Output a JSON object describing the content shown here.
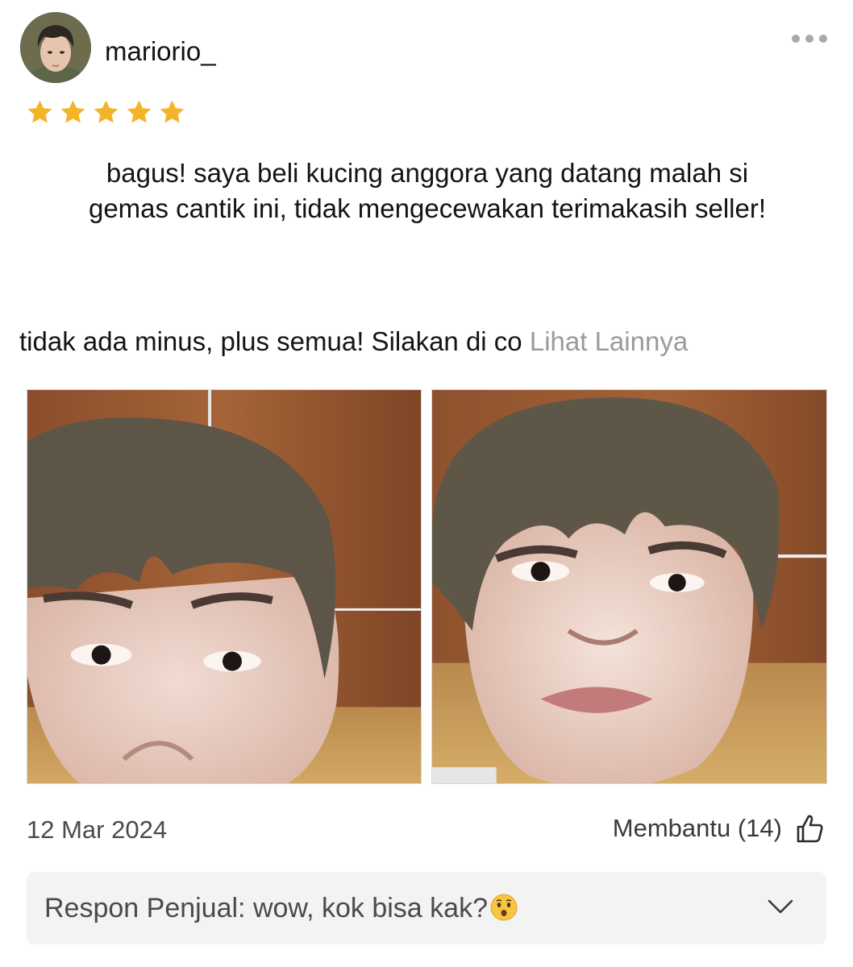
{
  "review": {
    "username": "mariorio_",
    "rating": 5,
    "rating_max": 5,
    "text_line_1": "bagus! saya beli kucing anggora yang datang malah si",
    "text_line_2": "gemas cantik ini, tidak mengecewakan terimakasih seller!",
    "text_line_3": "tidak ada minus, plus semua! Silakan di co",
    "see_more_label": "Lihat Lainnya",
    "photos": [
      "review-photo-1",
      "review-photo-2"
    ],
    "date": "12 Mar 2024",
    "helpful_label": "Membantu (14)"
  },
  "seller_response": {
    "text": "Respon Penjual: wow, kok bisa kak?",
    "emoji_icon": "hushed-face-emoji-icon",
    "expand_icon": "chevron-down-icon"
  },
  "icons": {
    "more": "more-options-icon",
    "star": "star-icon",
    "helpful": "thumbs-up-icon"
  },
  "colors": {
    "star": "#f4b42a",
    "muted_text": "#9a9a9a",
    "panel_bg": "#f3f3f3"
  }
}
